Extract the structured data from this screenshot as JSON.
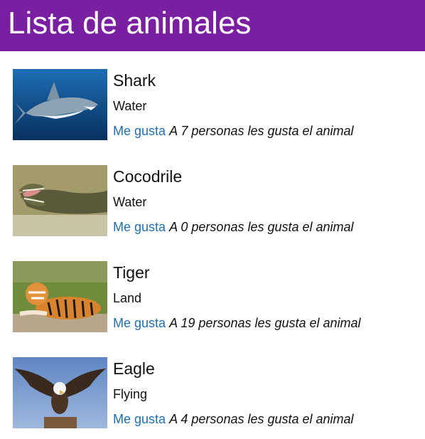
{
  "header": {
    "title": "Lista de animales"
  },
  "animals": [
    {
      "name": "Shark",
      "habitat": "Water",
      "like_label": "Me gusta",
      "likes_text": "A 7 personas les gusta el animal",
      "image": "shark-photo"
    },
    {
      "name": "Cocodrile",
      "habitat": "Water",
      "like_label": "Me gusta",
      "likes_text": "A 0 personas les gusta el animal",
      "image": "crocodile-photo"
    },
    {
      "name": "Tiger",
      "habitat": "Land",
      "like_label": "Me gusta",
      "likes_text": "A 19 personas les gusta el animal",
      "image": "tiger-photo"
    },
    {
      "name": "Eagle",
      "habitat": "Flying",
      "like_label": "Me gusta",
      "likes_text": "A 4 personas les gusta el animal",
      "image": "eagle-photo"
    }
  ],
  "colors": {
    "header_bg": "#7b1fa2",
    "link": "#1f6fb5"
  }
}
